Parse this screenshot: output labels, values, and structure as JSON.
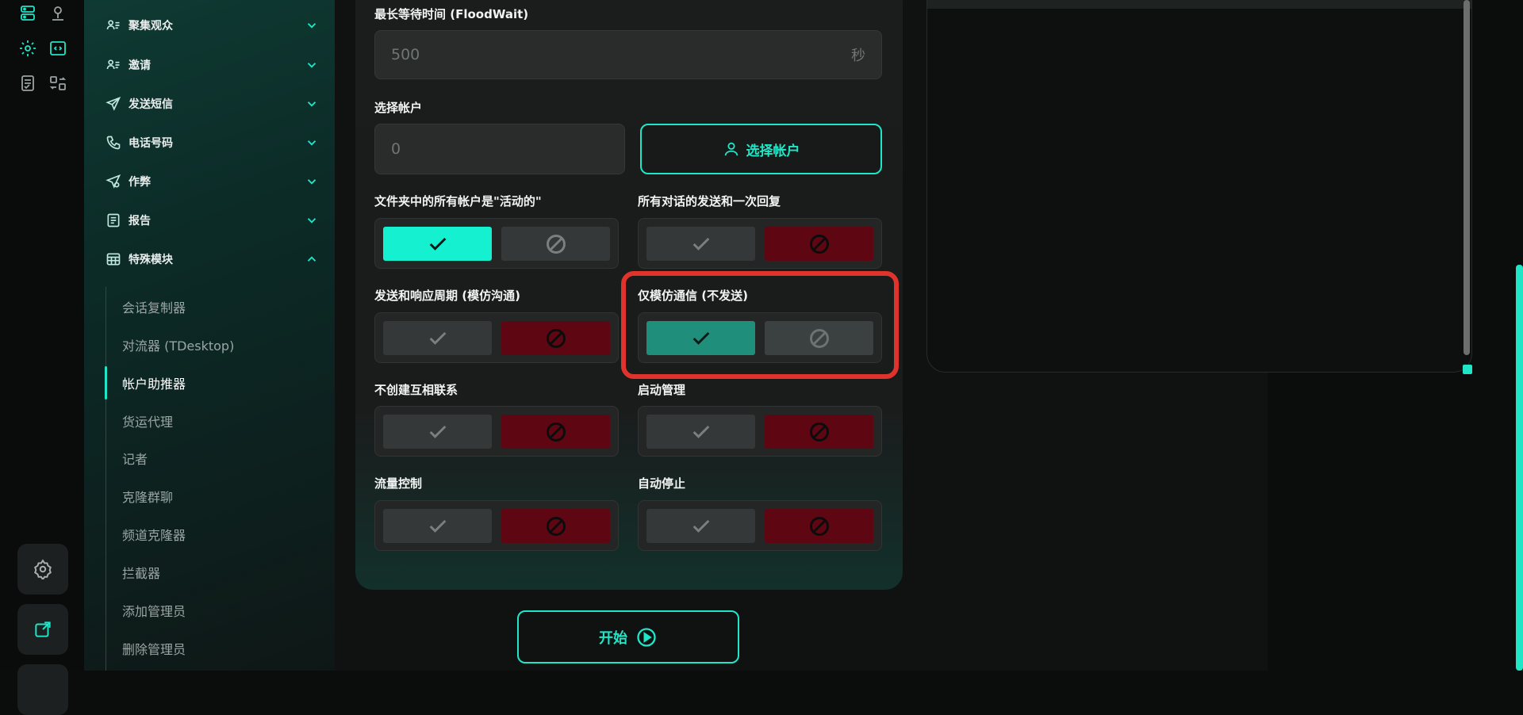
{
  "sidebar": {
    "menu": [
      {
        "label": "聚集观众",
        "icon": "user-list-icon",
        "expanded": false
      },
      {
        "label": "邀请",
        "icon": "user-add-icon",
        "expanded": false
      },
      {
        "label": "发送短信",
        "icon": "send-icon",
        "expanded": false
      },
      {
        "label": "电话号码",
        "icon": "phone-icon",
        "expanded": false
      },
      {
        "label": "作弊",
        "icon": "send-gear-icon",
        "expanded": false
      },
      {
        "label": "报告",
        "icon": "report-icon",
        "expanded": false
      },
      {
        "label": "特殊模块",
        "icon": "grid-icon",
        "expanded": true
      }
    ],
    "submenu": [
      "会话复制器",
      "对流器 (TDesktop)",
      "帐户助推器",
      "货运代理",
      "记者",
      "克隆群聊",
      "频道克隆器",
      "拦截器",
      "添加管理员",
      "删除管理员"
    ],
    "active_submenu": "帐户助推器"
  },
  "form": {
    "floodwait_label": "最长等待时间 (FloodWait)",
    "floodwait_value": "500",
    "floodwait_unit": "秒",
    "select_account_label": "选择帐户",
    "account_count": "0",
    "select_account_button": "选择帐户",
    "toggles": [
      {
        "label": "文件夹中的所有帐户是\"活动的\"",
        "value": true
      },
      {
        "label": "所有对话的发送和一次回复",
        "value": false
      },
      {
        "label": "发送和响应周期 (模仿沟通)",
        "value": false
      },
      {
        "label": "仅模仿通信 (不发送)",
        "value": true,
        "highlighted": true
      },
      {
        "label": "不创建互相联系",
        "value": false
      },
      {
        "label": "启动管理",
        "value": false
      },
      {
        "label": "流量控制",
        "value": false
      },
      {
        "label": "自动停止",
        "value": false
      }
    ],
    "start_button": "开始"
  },
  "colors": {
    "accent": "#1fe6c7",
    "danger": "#5e0612",
    "highlight_box": "#e0332b"
  }
}
